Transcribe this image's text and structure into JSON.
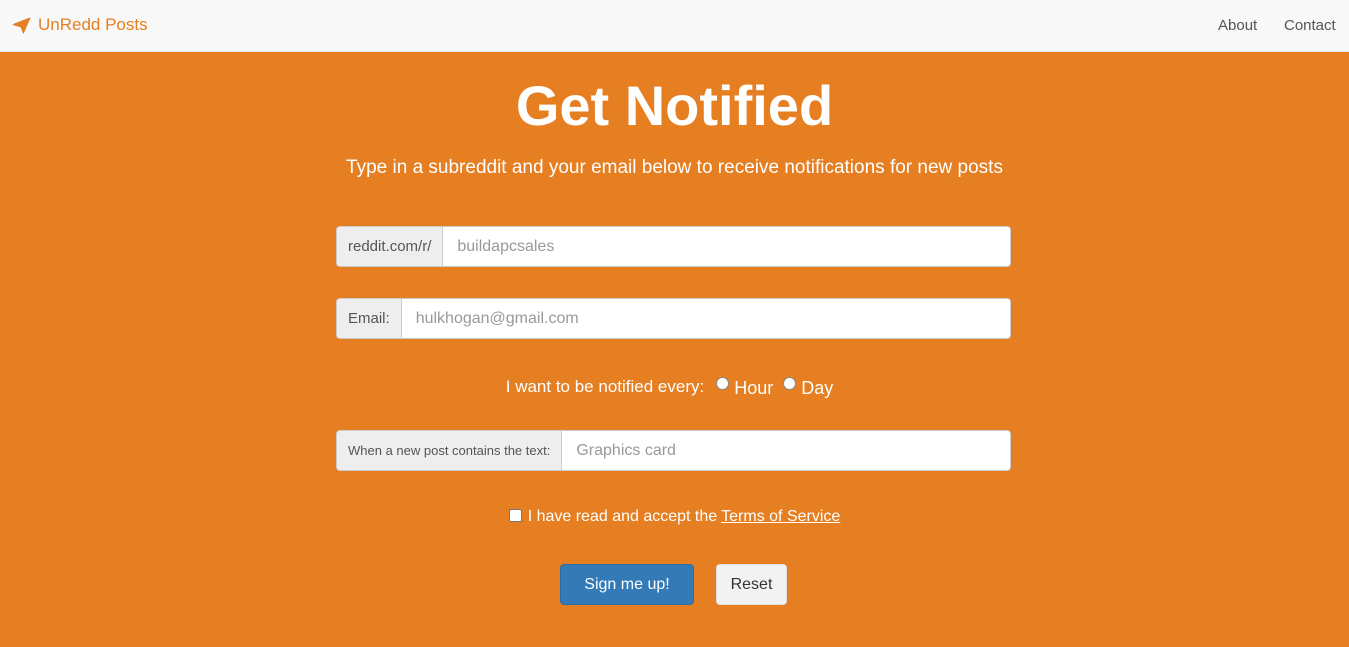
{
  "brand": {
    "icon": "paper-plane-icon",
    "name": "UnRedd Posts",
    "color": "#e67e22"
  },
  "nav": {
    "about": "About",
    "contact": "Contact"
  },
  "hero": {
    "title": "Get Notified",
    "subtitle": "Type in a subreddit and your email below to receive notifications for new posts"
  },
  "form": {
    "subreddit": {
      "prefix": "reddit.com/r/",
      "placeholder": "buildapcsales"
    },
    "email": {
      "prefix": "Email:",
      "placeholder": "hulkhogan@gmail.com"
    },
    "frequency": {
      "label": "I want to be notified every:",
      "options": [
        "Hour",
        "Day"
      ]
    },
    "text": {
      "prefix": "When a new post contains the text:",
      "placeholder": "Graphics card"
    },
    "terms": {
      "text": "I have read and accept the",
      "link": "Terms of Service"
    },
    "submit": "Sign me up!",
    "reset": "Reset"
  },
  "colors": {
    "background": "#e67e22",
    "primary": "#337ab7"
  }
}
